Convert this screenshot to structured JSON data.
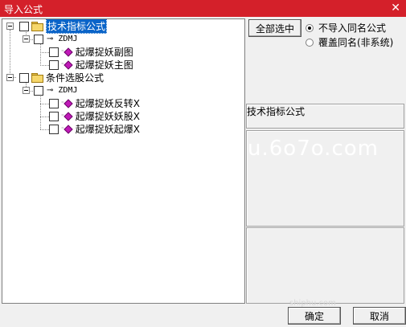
{
  "window": {
    "title": "导入公式",
    "close_glyph": "✕"
  },
  "tree": {
    "root1": {
      "label": "技术指标公式",
      "selected": true
    },
    "group1": {
      "label": "ZDMJ"
    },
    "group1_items": [
      "起爆捉妖副图",
      "起爆捉妖主图"
    ],
    "root2": {
      "label": "条件选股公式"
    },
    "group2": {
      "label": "ZDMJ"
    },
    "group2_items": [
      "起爆捉妖反转X",
      "起爆捉妖妖股X",
      "起爆捉妖起爆X"
    ]
  },
  "right": {
    "select_all_label": "全部选中",
    "radio_options": [
      {
        "label": "不导入同名公式",
        "checked": true
      },
      {
        "label": "覆盖同名(非系统)",
        "checked": false
      }
    ],
    "info_label": "技术指标公式",
    "watermark": "u.6o7o.com",
    "watermark_small": "shiphu.com"
  },
  "footer": {
    "ok_label": "确定",
    "cancel_label": "取消"
  }
}
